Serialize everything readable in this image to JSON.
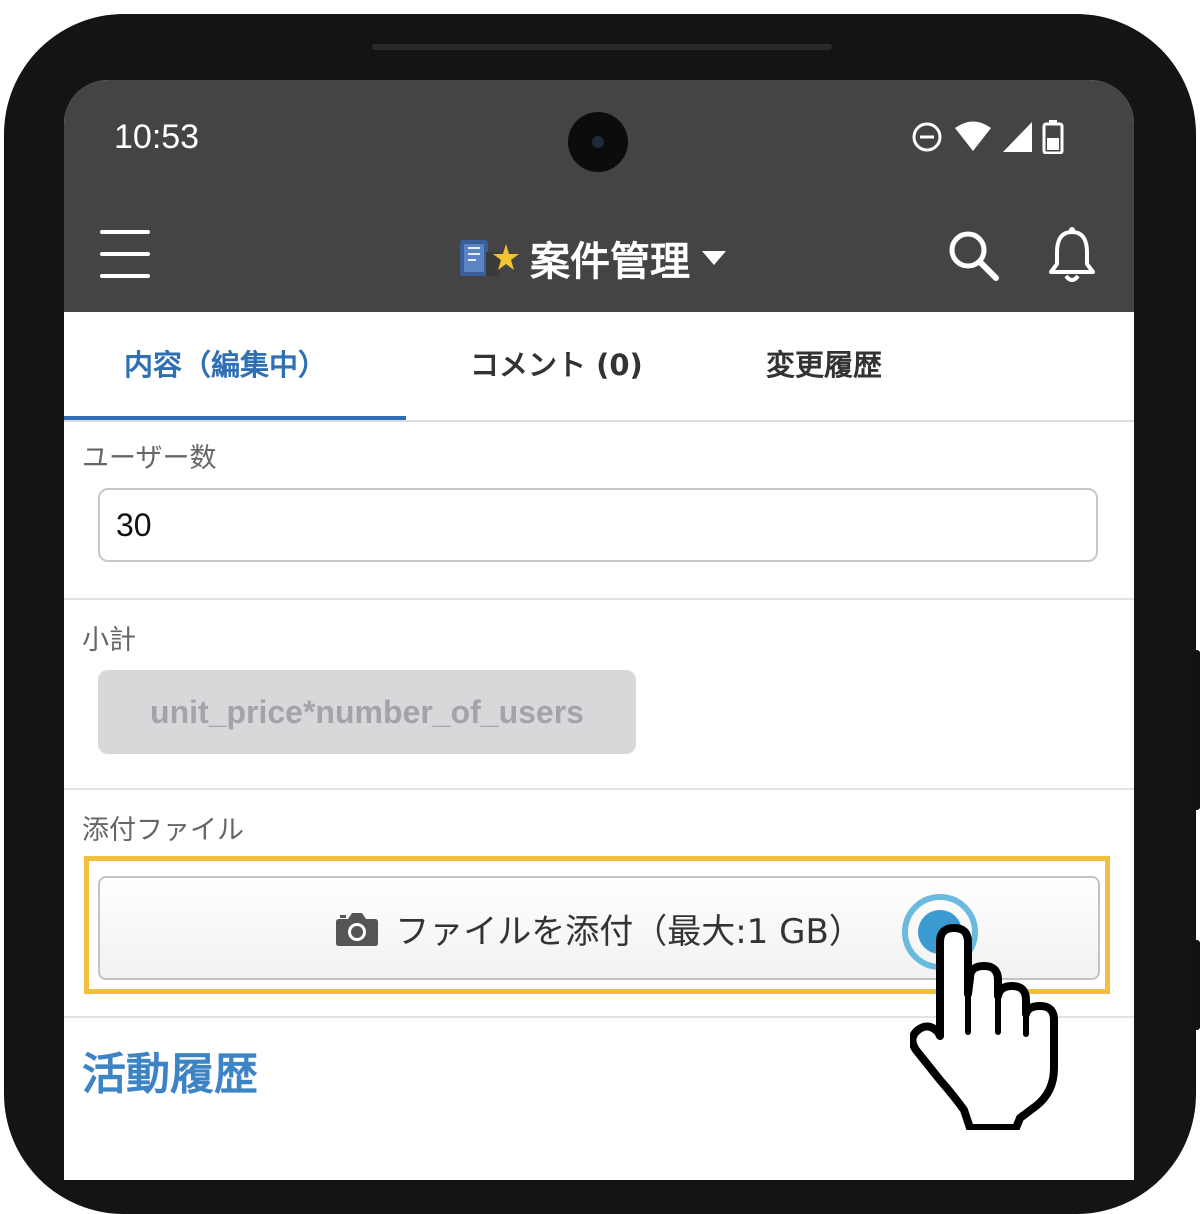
{
  "status_bar": {
    "time": "10:53"
  },
  "app_bar": {
    "title": "案件管理"
  },
  "tabs": [
    {
      "label": "内容（編集中）",
      "active": true
    },
    {
      "label": "コメント (0)",
      "active": false
    },
    {
      "label": "変更履歴",
      "active": false
    }
  ],
  "fields": {
    "users": {
      "label": "ユーザー数",
      "value": "30"
    },
    "subtotal": {
      "label": "小計",
      "formula": "unit_price*number_of_users"
    },
    "attachment": {
      "label": "添付ファイル",
      "button_label": "ファイルを添付（最大:1 GB）"
    }
  },
  "activity": {
    "title": "活動履歴"
  },
  "colors": {
    "appbar": "#444444",
    "accent_blue": "#2f6fb4",
    "section_title_blue": "#3d84c6",
    "highlight_yellow": "#f1be3f",
    "tap_indicator": "#3a9bd2"
  },
  "icons": [
    "menu-icon",
    "app-logo-icon",
    "dropdown-caret-icon",
    "search-icon",
    "bell-icon",
    "dnd-icon",
    "wifi-icon",
    "signal-icon",
    "battery-icon",
    "camera-icon",
    "hand-pointer-icon"
  ]
}
